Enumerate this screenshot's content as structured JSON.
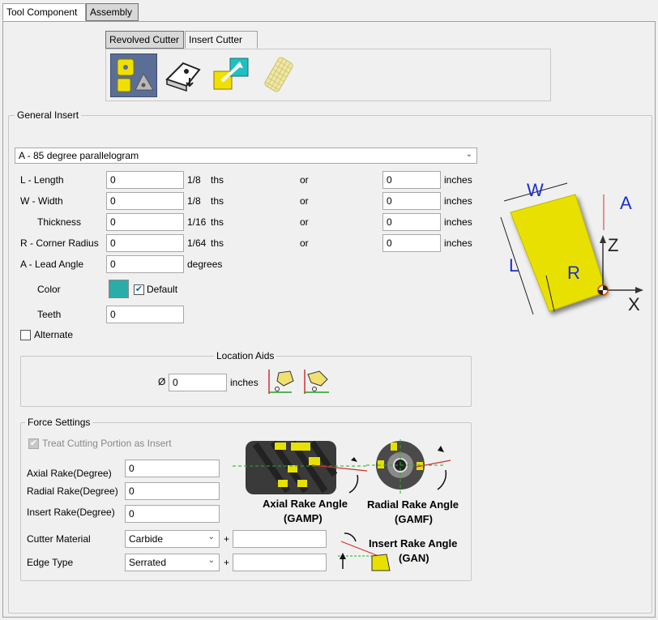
{
  "tabs": [
    {
      "label": "Tool Component"
    },
    {
      "label": "Assembly"
    }
  ],
  "subtabs": [
    {
      "label": "Revolved Cutter"
    },
    {
      "label": "Insert Cutter"
    }
  ],
  "general": {
    "title": "General Insert",
    "shape": "A - 85 degree parallelogram",
    "or": "or",
    "length": {
      "label": "L - Length",
      "value": "0",
      "unit": "1/8",
      "ths": "ths",
      "inches_value": "0",
      "inches": "inches"
    },
    "width": {
      "label": "W - Width",
      "value": "0",
      "unit": "1/8",
      "ths": "ths",
      "inches_value": "0",
      "inches": "inches"
    },
    "thickness": {
      "label": "Thickness",
      "value": "0",
      "unit": "1/16",
      "ths": "ths",
      "inches_value": "0",
      "inches": "inches"
    },
    "radius": {
      "label": "R - Corner Radius",
      "value": "0",
      "unit": "1/64",
      "ths": "ths",
      "inches_value": "0",
      "inches": "inches"
    },
    "lead": {
      "label": "A - Lead Angle",
      "value": "0",
      "unit": "degrees"
    },
    "color": {
      "label": "Color",
      "swatch": "#2aada8",
      "default_label": "Default",
      "default_checked": true
    },
    "teeth": {
      "label": "Teeth",
      "value": "0"
    },
    "alternate": {
      "label": "Alternate",
      "checked": false
    }
  },
  "diagram": {
    "w": "W",
    "a": "A",
    "z": "Z",
    "l": "L",
    "r": "R",
    "x": "X"
  },
  "location": {
    "title": "Location Aids",
    "symbol": "Ø",
    "value": "0",
    "unit": "inches"
  },
  "force": {
    "title": "Force Settings",
    "treat_label": "Treat Cutting Portion as Insert",
    "axial": {
      "label": "Axial Rake(Degree)",
      "value": "0"
    },
    "radial": {
      "label": "Radial Rake(Degree)",
      "value": "0"
    },
    "insert": {
      "label": "Insert Rake(Degree)",
      "value": "0"
    },
    "material": {
      "label": "Cutter Material",
      "value": "Carbide",
      "plus": "+",
      "extra": ""
    },
    "edge": {
      "label": "Edge Type",
      "value": "Serrated",
      "plus": "+",
      "extra": ""
    },
    "axial_caption": "Axial Rake Angle",
    "axial_code": "(GAMP)",
    "radial_caption": "Radial Rake Angle",
    "radial_code": "(GAMF)",
    "insert_caption": "Insert Rake Angle",
    "insert_code": "(GAN)"
  },
  "colors": {
    "accent": "#2060c0",
    "insert_yellow": "#e8e000",
    "blue_text": "#1a2fd0"
  }
}
